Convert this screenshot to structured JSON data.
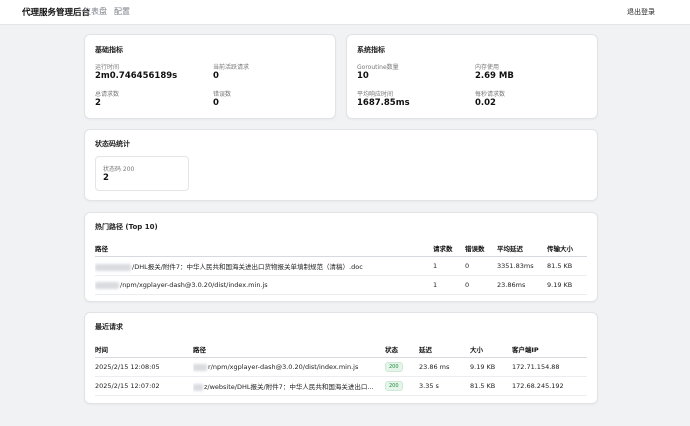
{
  "header": {
    "brand": "代理服务管理后台",
    "nav": [
      "仪表盘",
      "配置"
    ],
    "logout": "退出登录"
  },
  "basic_metrics": {
    "title": "基础指标",
    "items": [
      {
        "label": "运行时间",
        "value": "2m0.746456189s"
      },
      {
        "label": "当前活跃请求",
        "value": "0"
      },
      {
        "label": "总请求数",
        "value": "2"
      },
      {
        "label": "错误数",
        "value": "0"
      }
    ]
  },
  "system_metrics": {
    "title": "系统指标",
    "items": [
      {
        "label": "Goroutine数量",
        "value": "10"
      },
      {
        "label": "内存使用",
        "value": "2.69 MB"
      },
      {
        "label": "平均响应时间",
        "value": "1687.85ms"
      },
      {
        "label": "每秒请求数",
        "value": "0.02"
      }
    ]
  },
  "status_codes": {
    "title": "状态码统计",
    "items": [
      {
        "label": "状态码 200",
        "value": "2"
      }
    ]
  },
  "top_paths": {
    "title": "热门路径 (Top 10)",
    "columns": [
      "路径",
      "请求数",
      "错误数",
      "平均延迟",
      "传输大小"
    ],
    "rows": [
      {
        "path": "/DHL报关/附件7：中华人民共和国海关进出口货物报关单填制规范（清稿）.doc",
        "requests": "1",
        "errors": "0",
        "latency": "3351.83ms",
        "size": "81.5 KB"
      },
      {
        "path": "/npm/xgplayer-dash@3.0.20/dist/index.min.js",
        "requests": "1",
        "errors": "0",
        "latency": "23.86ms",
        "size": "9.19 KB"
      }
    ]
  },
  "recent_requests": {
    "title": "最近请求",
    "columns": [
      "时间",
      "路径",
      "状态",
      "延迟",
      "大小",
      "客户端IP"
    ],
    "rows": [
      {
        "time": "2025/2/15 12:08:05",
        "path": "r/npm/xgplayer-dash@3.0.20/dist/index.min.js",
        "status": "200",
        "latency": "23.86 ms",
        "size": "9.19 KB",
        "ip": "172.71.154.88"
      },
      {
        "time": "2025/2/15 12:07:02",
        "path": "z/website/DHL报关/附件7：中华人民共和国海关进出口...",
        "status": "200",
        "latency": "3.35 s",
        "size": "81.5 KB",
        "ip": "172.68.245.192"
      }
    ]
  }
}
